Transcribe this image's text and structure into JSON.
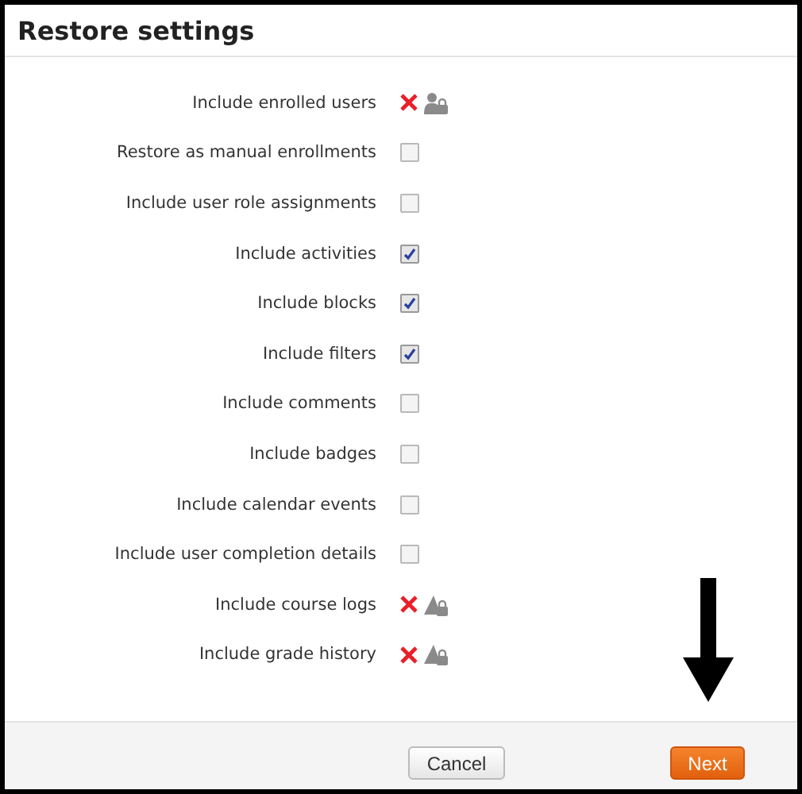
{
  "dialog": {
    "title": "Restore settings"
  },
  "settings": [
    {
      "label": "Include enrolled users",
      "kind": "locked_user",
      "checked": false
    },
    {
      "label": "Restore as manual enrollments",
      "kind": "checkbox",
      "checked": false
    },
    {
      "label": "Include user role assignments",
      "kind": "checkbox",
      "checked": false
    },
    {
      "label": "Include activities",
      "kind": "checkbox",
      "checked": true
    },
    {
      "label": "Include blocks",
      "kind": "checkbox",
      "checked": true
    },
    {
      "label": "Include filters",
      "kind": "checkbox",
      "checked": true
    },
    {
      "label": "Include comments",
      "kind": "checkbox",
      "checked": false
    },
    {
      "label": "Include badges",
      "kind": "checkbox",
      "checked": false
    },
    {
      "label": "Include calendar events",
      "kind": "checkbox",
      "checked": false
    },
    {
      "label": "Include user completion details",
      "kind": "checkbox",
      "checked": false
    },
    {
      "label": "Include course logs",
      "kind": "locked",
      "checked": false
    },
    {
      "label": "Include grade history",
      "kind": "locked",
      "checked": false
    }
  ],
  "buttons": [
    {
      "label": "Cancel",
      "kind": "secondary"
    },
    {
      "label": "Next",
      "kind": "primary"
    }
  ]
}
